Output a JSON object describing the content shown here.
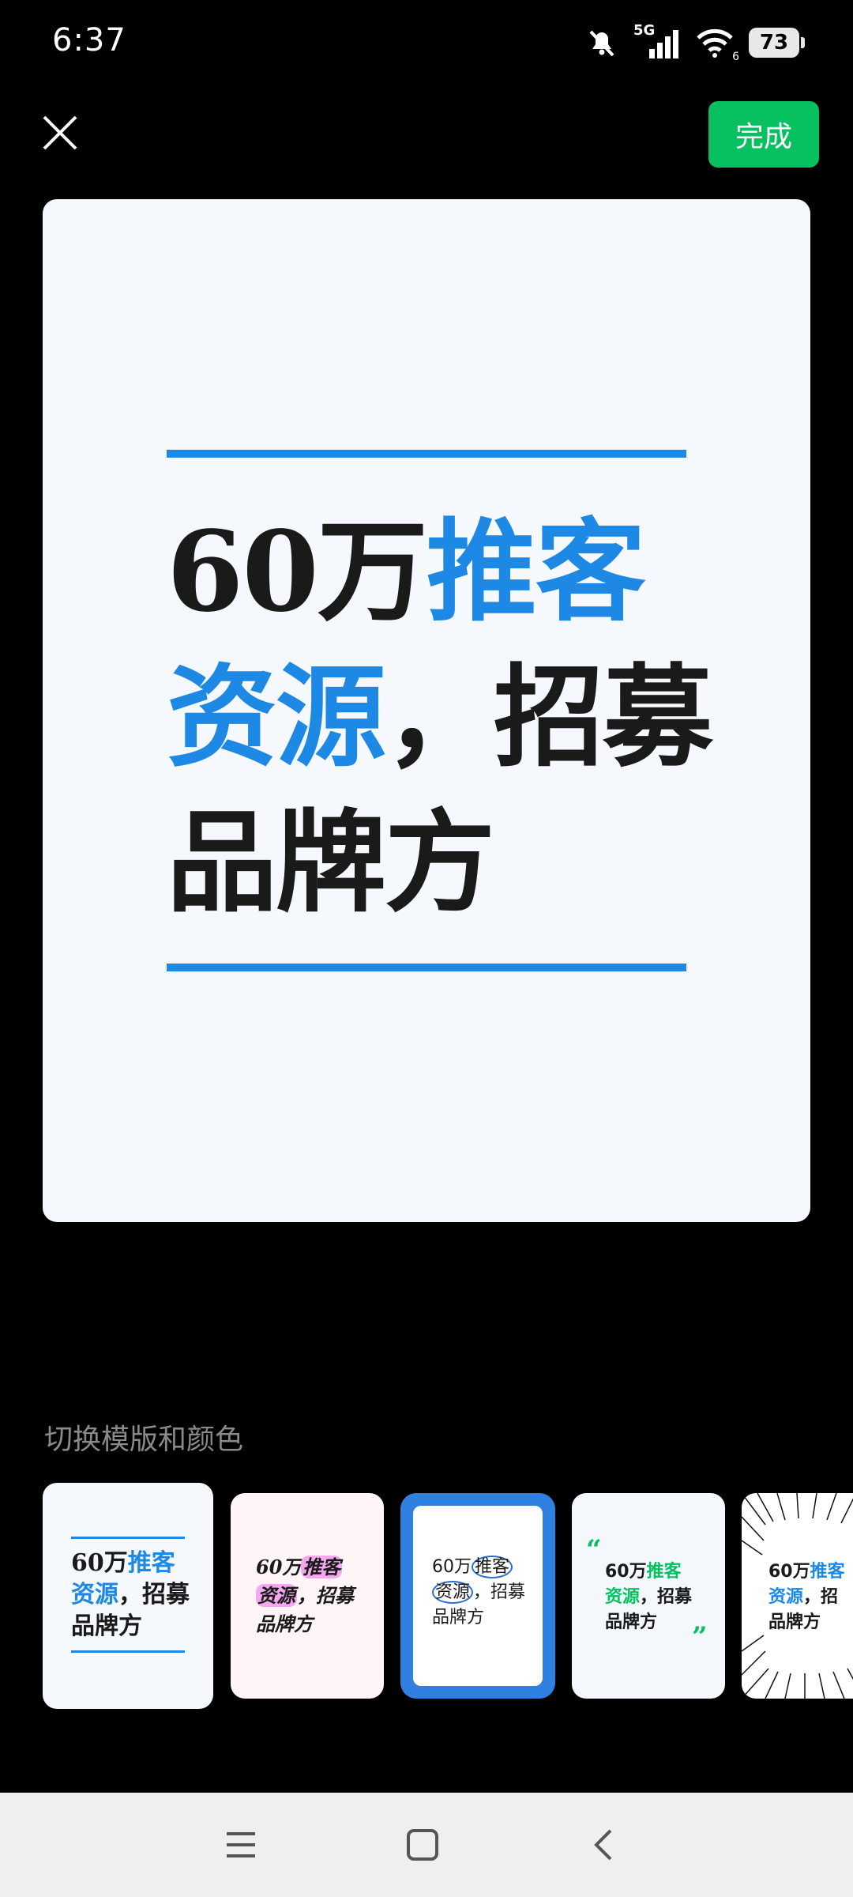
{
  "status_bar": {
    "time": "6:37",
    "network": "5G",
    "wifi_badge": "6",
    "battery": "73"
  },
  "header": {
    "close_icon": "close-icon",
    "done_label": "完成",
    "accent_color": "#07c160"
  },
  "preview": {
    "line1_a": "60万",
    "line1_b": "推客",
    "line2_a": "资源",
    "line2_b": "，招募",
    "line3": "品牌方",
    "accent_color": "#1e88e5"
  },
  "templates": {
    "section_label": "切换模版和颜色",
    "items": [
      {
        "a": "60万",
        "b": "推客",
        "c": "资源",
        "d": "，招募",
        "e": "品牌方"
      },
      {
        "a": "60万",
        "b": "推客",
        "c": "资源",
        "d": "，招募",
        "e": "品牌方"
      },
      {
        "a": "60万",
        "b": "推客",
        "c": "资源",
        "d": "，招募",
        "e": "品牌方"
      },
      {
        "a": "60万",
        "b": "推客",
        "c": "资源",
        "d": "，招募",
        "e": "品牌方"
      },
      {
        "a": "60万",
        "b": "推客",
        "c": "资源",
        "d": "，招",
        "e": "品牌方"
      }
    ]
  },
  "nav": {
    "menu_icon": "menu-icon",
    "home_icon": "home-icon",
    "back_icon": "back-icon"
  }
}
